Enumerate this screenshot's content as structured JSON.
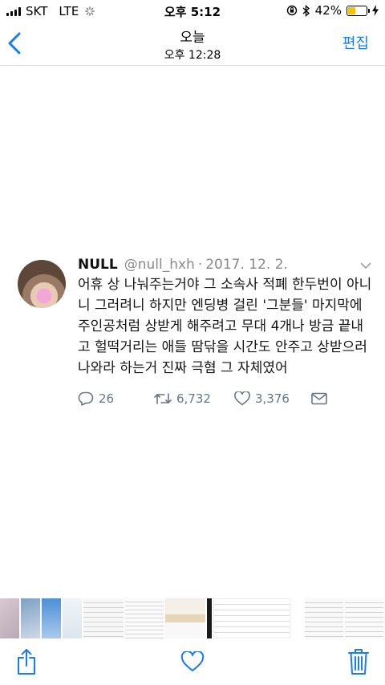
{
  "status_bar": {
    "carrier": "SKT",
    "network": "LTE",
    "time": "오후 5:12",
    "battery_text": "42%",
    "battery_level": 0.42,
    "icons": [
      "signal-icon",
      "loading-spinner-icon",
      "orientation-lock-icon",
      "bluetooth-icon",
      "battery-icon",
      "charging-icon"
    ]
  },
  "nav": {
    "title": "오늘",
    "subtitle": "오후 12:28",
    "edit_label": "편집",
    "back_icon": "back-chevron-icon"
  },
  "tweet": {
    "name": "NULL",
    "handle": "@null_hxh",
    "separator": "·",
    "date": "2017. 12. 2.",
    "text": "어휴 상 나눠주는거야 그 소속사 적폐 한두번이 아니니 그러려니 하지만 엔딩병 걸린 '그분들' 마지막에 주인공처럼 상받게 해주려고 무대 4개나 방금 끝내고 헐떡거리는 애들 땀닦을 시간도 안주고 상받으러 나와라 하는거 진짜 극혐 그 자체였어",
    "replies": "26",
    "retweets": "6,732",
    "likes": "3,376"
  },
  "toolbar": {
    "icons": [
      "share-icon",
      "heart-icon",
      "trash-icon"
    ]
  },
  "colors": {
    "accent": "#1a7cf5",
    "muted": "#8a8a8a",
    "action_gray": "#657786",
    "battery": "#f5c400"
  }
}
